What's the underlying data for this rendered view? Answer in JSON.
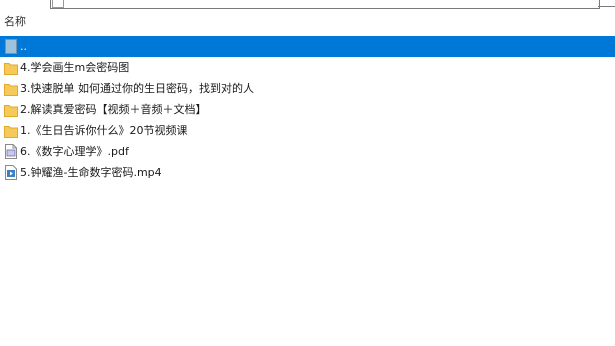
{
  "header": {
    "name_column": "名称"
  },
  "items": [
    {
      "label": "..",
      "icon": "parent-folder-icon",
      "selected": true
    },
    {
      "label": "4.学会画生m会密码图",
      "icon": "folder-icon",
      "selected": false
    },
    {
      "label": "3.快速脱单 如何通过你的生日密码，找到对的人",
      "icon": "folder-icon",
      "selected": false
    },
    {
      "label": "2.解读真爱密码【视频＋音频＋文档】",
      "icon": "folder-icon",
      "selected": false
    },
    {
      "label": "1.《生日告诉你什么》20节视频课",
      "icon": "folder-icon",
      "selected": false
    },
    {
      "label": "6.《数字心理学》.pdf",
      "icon": "pdf-file-icon",
      "selected": false
    },
    {
      "label": "5.钟耀渔-生命数字密码.mp4",
      "icon": "video-file-icon",
      "selected": false
    }
  ],
  "colors": {
    "selection": "#0078d7",
    "folder": "#f5c95a",
    "folder_dark": "#e3a92c"
  }
}
